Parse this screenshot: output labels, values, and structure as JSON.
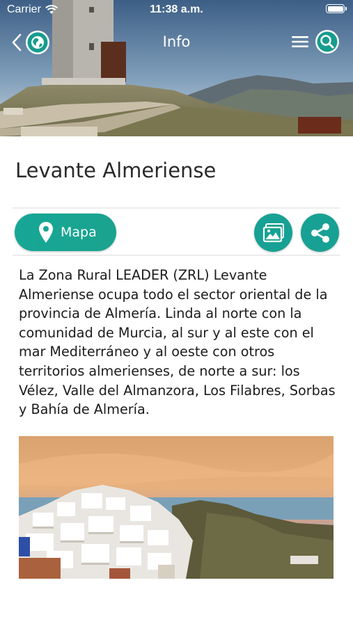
{
  "status_bar": {
    "carrier": "Carrier",
    "time": "11:38 a.m."
  },
  "nav": {
    "title": "Info",
    "back_icon": "chevron-left-icon",
    "globe_icon": "globe-icon",
    "menu_icon": "hamburger-menu-icon",
    "search_icon": "search-icon"
  },
  "page": {
    "title": "Levante Almeriense"
  },
  "actions": {
    "map_label": "Mapa",
    "map_icon": "map-pin-icon",
    "gallery_icon": "gallery-icon",
    "share_icon": "share-icon"
  },
  "description": "La Zona Rural LEADER (ZRL) Levante Almeriense ocupa todo el sector oriental de la provincia de Almería. Linda al norte con la comunidad de Murcia, al sur y al este con el mar Mediterráneo y al oeste con otros territorios almerienses, de norte a sur: los Vélez, Valle del Almanzora, Los Filabres, Sorbas y Bahía de Almería.",
  "colors": {
    "accent": "#17a194",
    "accent_light": "#1aa38f",
    "text": "#1c1c1c",
    "divider": "#ececec"
  }
}
